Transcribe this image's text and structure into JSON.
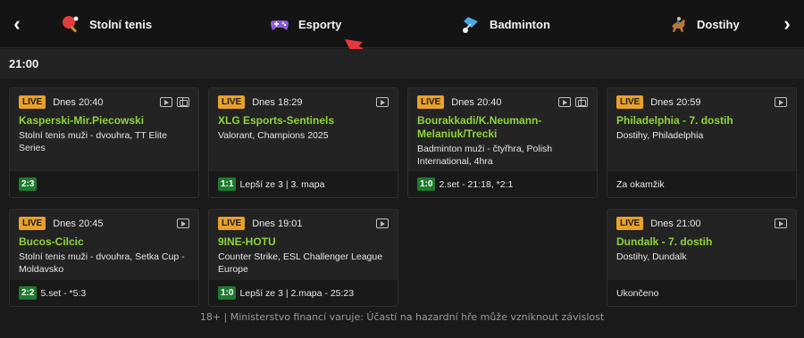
{
  "nav": {
    "tabs": [
      {
        "label": "Stolní tenis",
        "icon": "table-tennis-icon"
      },
      {
        "label": "Esporty",
        "icon": "gamepad-icon"
      },
      {
        "label": "Badminton",
        "icon": "shuttlecock-icon"
      },
      {
        "label": "Dostihy",
        "icon": "horse-racing-icon"
      }
    ]
  },
  "section": {
    "time": "21:00"
  },
  "cards": [
    {
      "live": "LIVE",
      "time": "Dnes 20:40",
      "title": "Kasperski-Mir.Piecowski",
      "desc": "Stolní tenis muži - dvouhra, TT Elite Series",
      "score": "2:3",
      "status": ""
    },
    {
      "live": "LIVE",
      "time": "Dnes 18:29",
      "title": "XLG Esports-Sentinels",
      "desc": "Valorant, Champions 2025",
      "score": "1:1",
      "status": "Lepší ze 3 | 3. mapa"
    },
    {
      "live": "LIVE",
      "time": "Dnes 20:40",
      "title": "Bourakkadi/K.Neumann-Melaniuk/Trecki",
      "desc": "Badminton muži - čtyřhra, Polish International, 4hra",
      "score": "1:0",
      "status": "2.set - 21:18, *2:1"
    },
    {
      "live": "LIVE",
      "time": "Dnes 20:59",
      "title": "Philadelphia - 7. dostih",
      "desc": "Dostihy, Philadelphia",
      "score": "",
      "status": "Za okamžik"
    },
    {
      "live": "LIVE",
      "time": "Dnes 20:45",
      "title": "Bucos-Cilcic",
      "desc": "Stolní tenis muži - dvouhra, Setka Cup - Moldavsko",
      "score": "2:2",
      "status": "5.set - *5:3"
    },
    {
      "live": "LIVE",
      "time": "Dnes 19:01",
      "title": "9INE-HOTU",
      "desc": "Counter Strike, ESL Challenger League Europe",
      "score": "1:0",
      "status": "Lepší ze 3 | 2.mapa - 25:23"
    },
    {
      "live": "LIVE",
      "time": "Dnes 21:00",
      "title": "Dundalk - 7. dostih",
      "desc": "Dostihy, Dundalk",
      "score": "",
      "status": "Ukončeno"
    }
  ],
  "footer": {
    "disclaimer": "18+ | Ministerstvo financí varuje: Účastí na hazardní hře může vzniknout závislost"
  },
  "colors": {
    "accent_green": "#8ed53a",
    "live_orange": "#e8a12a",
    "score_green": "#1f7a2f",
    "annotation_red": "#e8373c"
  }
}
